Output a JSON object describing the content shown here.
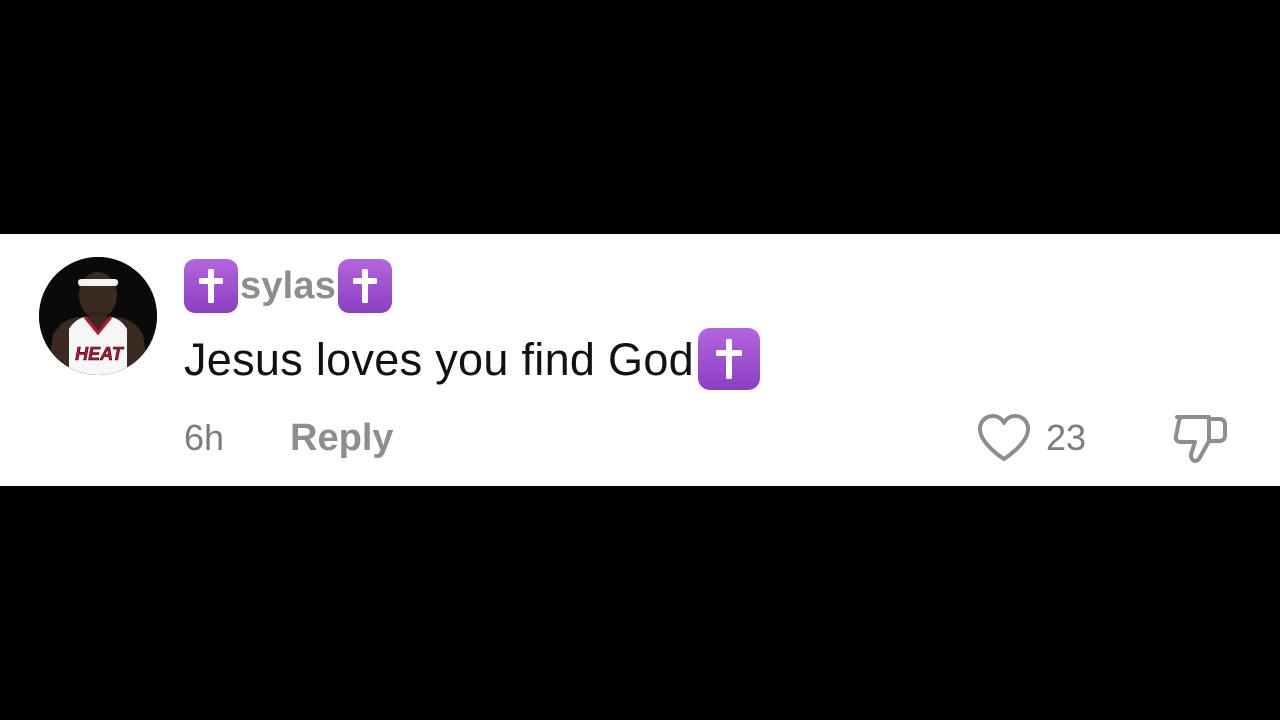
{
  "comment": {
    "avatar_icon": "profile-photo",
    "username": "sylas",
    "username_prefix_emoji": "cross-icon",
    "username_suffix_emoji": "cross-icon",
    "text": "Jesus loves you find God",
    "text_suffix_emoji": "cross-icon",
    "timestamp": "6h",
    "reply_label": "Reply",
    "like_icon": "heart-icon",
    "like_count": "23",
    "dislike_icon": "thumbs-down-icon"
  },
  "colors": {
    "card_background": "#ffffff",
    "page_background": "#000000",
    "username": "#8e8e8e",
    "comment_text": "#111111",
    "meta_text": "#7d7d7d",
    "emoji_purple": "#9b4fcf"
  },
  "avatar": {
    "jersey_text": "HEAT"
  }
}
